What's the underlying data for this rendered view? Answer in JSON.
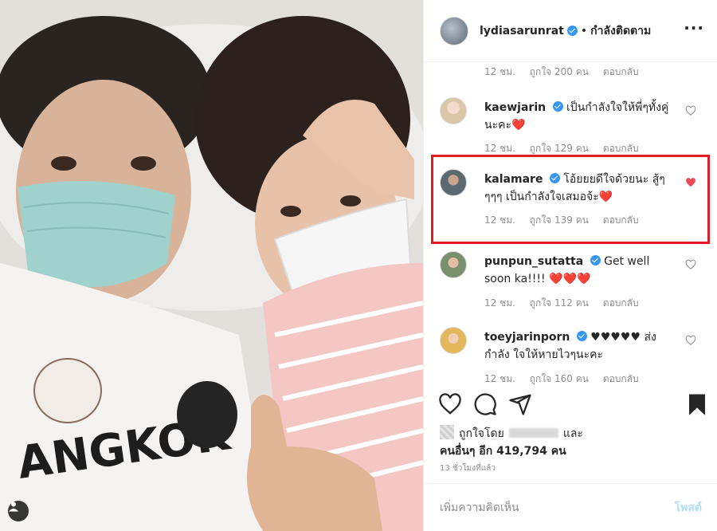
{
  "post": {
    "username": "lydiasarunrat",
    "separator": "•",
    "follow_status": "กำลังติดตาม",
    "more_icon": "more-horizontal-icon"
  },
  "first_meta": {
    "time": "12 ชม.",
    "likes": "ถูกใจ 200 คน",
    "reply": "ตอบกลับ"
  },
  "comments": [
    {
      "username": "kaewjarin",
      "verified": true,
      "text": "เป็นกำลังใจให้พี่ๆทั้งคู่ นะคะ❤️",
      "time": "12 ชม.",
      "likes": "ถูกใจ 129 คน",
      "reply": "ตอบกลับ",
      "liked": false
    },
    {
      "username": "kalamare",
      "verified": true,
      "text": "โอ้ยยยดีใจด้วยนะ สู้ๆ ๆๆๆ เป็นกำลังใจเสมอจ้ะ❤️",
      "time": "12 ชม.",
      "likes": "ถูกใจ 139 คน",
      "reply": "ตอบกลับ",
      "liked": true
    },
    {
      "username": "punpun_sutatta",
      "verified": true,
      "text": "Get well soon ka!!!! ❤️❤️❤️",
      "time": "12 ชม.",
      "likes": "ถูกใจ 112 คน",
      "reply": "ตอบกลับ",
      "liked": false
    },
    {
      "username": "toeyjarinporn",
      "verified": true,
      "text": "♥♥♥♥♥ ส่งกำลัง ใจให้หายไวๆนะคะ",
      "time": "12 ชม.",
      "likes": "ถูกใจ 160 คน",
      "reply": "ตอบกลับ",
      "liked": false
    }
  ],
  "likes": {
    "prefix": "ถูกใจโดย",
    "suffix": "และ",
    "others": "คนอื่นๆ อีก 419,794 คน"
  },
  "timestamp": "13 ชั่วโมงที่แล้ว",
  "add_comment": {
    "placeholder": "เพิ่มความคิดเห็น",
    "post_label": "โพสต์"
  },
  "colors": {
    "accent_blue": "#3897f0",
    "heart_red": "#ed4956",
    "highlight_red": "#e21b26",
    "muted": "#8e8e8e"
  }
}
